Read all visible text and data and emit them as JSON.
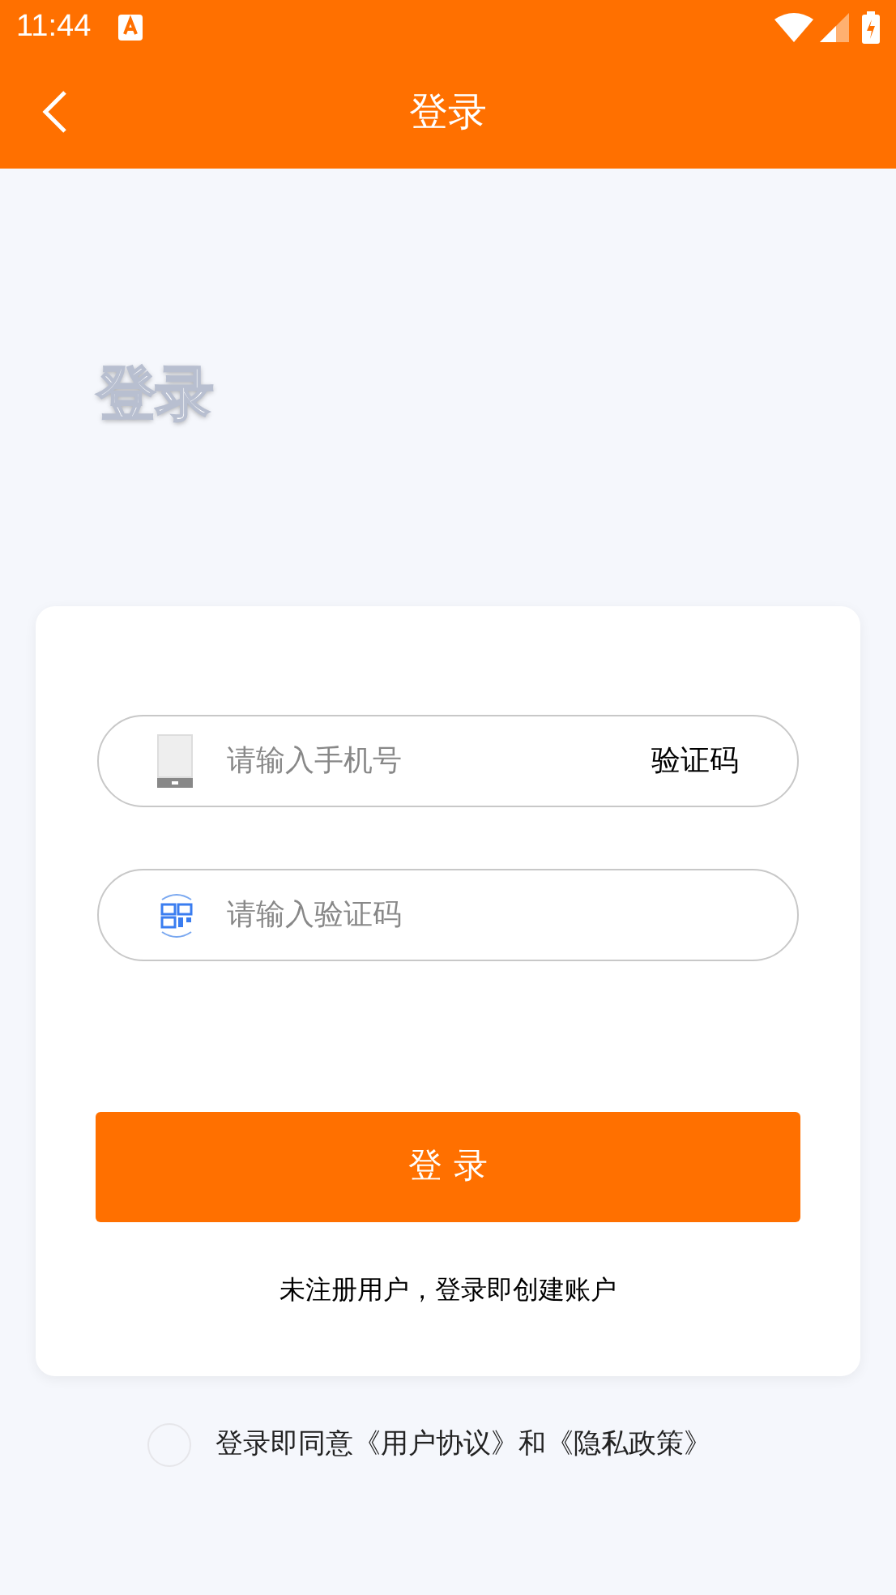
{
  "status_bar": {
    "time": "11:44"
  },
  "header": {
    "title": "登录"
  },
  "hero_title": "登录",
  "phone_field": {
    "placeholder": "请输入手机号",
    "code_button": "验证码"
  },
  "code_field": {
    "placeholder": "请输入验证码"
  },
  "login_button": "登 录",
  "register_hint": "未注册用户，登录即创建账户",
  "agreement": {
    "checked": false,
    "text": "登录即同意《用户协议》和《隐私政策》"
  }
}
